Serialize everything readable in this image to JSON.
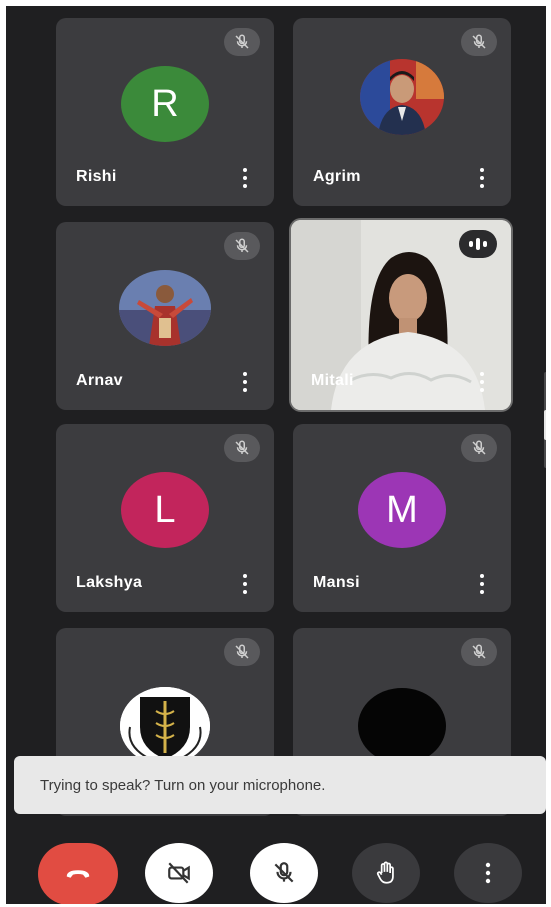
{
  "participants": [
    {
      "name": "Rishi",
      "initial": "R",
      "color": "#3b8a3a"
    },
    {
      "name": "Agrim"
    },
    {
      "name": "Arnav"
    },
    {
      "name": "Mitali"
    },
    {
      "name": "Lakshya",
      "initial": "L",
      "color": "#c2255c"
    },
    {
      "name": "Mansi",
      "initial": "M",
      "color": "#9c36b5"
    }
  ],
  "toast": {
    "text": "Trying to speak? Turn on your microphone."
  },
  "controls": [
    "end-call",
    "camera-off",
    "mic-off",
    "raise-hand",
    "more-options"
  ],
  "colors": {
    "background": "#1f1f21",
    "tile": "#3c3c3f",
    "end_call": "#e14c42"
  }
}
